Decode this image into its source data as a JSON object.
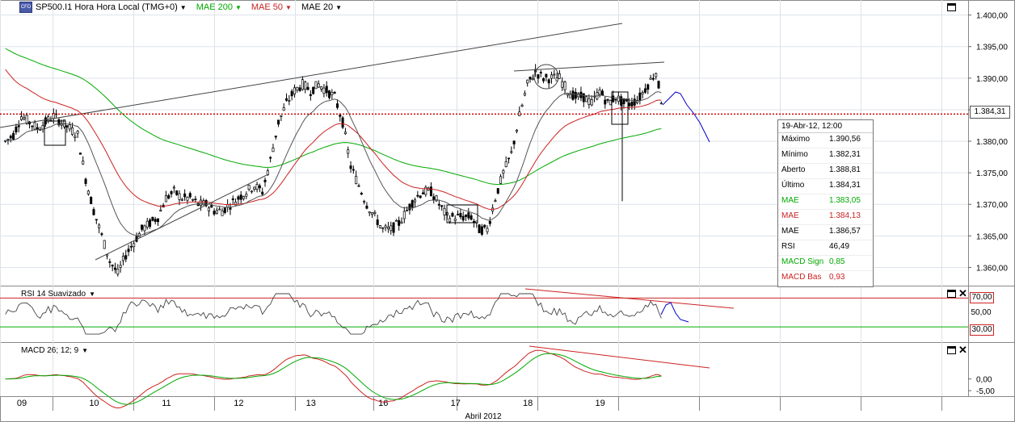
{
  "header": {
    "symbol_icon": "chart-logo-icon",
    "title": "SP500.I1 Hora Hora Local (TMG+0)",
    "indicators": [
      {
        "label": "MAE 200",
        "color": "#00aa00"
      },
      {
        "label": "MAE 50",
        "color": "#cc2222"
      },
      {
        "label": "MAE 20",
        "color": "#000000"
      }
    ]
  },
  "last_price_label": "1.384,31",
  "info_panel": {
    "date": "19-Abr-12, 12:00",
    "rows": [
      {
        "label": "Máximo",
        "value": "1.390,56",
        "color": "#000000"
      },
      {
        "label": "Mínimo",
        "value": "1.382,31",
        "color": "#000000"
      },
      {
        "label": "Aberto",
        "value": "1.388,81",
        "color": "#000000"
      },
      {
        "label": "Último",
        "value": "1.384,31",
        "color": "#000000"
      },
      {
        "label": "MAE",
        "value": "1.383,05",
        "color": "#00aa00"
      },
      {
        "label": "MAE",
        "value": "1.384,13",
        "color": "#cc2222"
      },
      {
        "label": "MAE",
        "value": "1.386,57",
        "color": "#000000"
      },
      {
        "label": "RSI",
        "value": "46,49",
        "color": "#000000"
      },
      {
        "label": "MACD Sign",
        "value": "0,85",
        "color": "#00aa00"
      },
      {
        "label": "MACD Bas",
        "value": "0,93",
        "color": "#cc2222"
      }
    ]
  },
  "rsi_pane": {
    "label": "RSI 14 Suavizado",
    "upper_label": "70,00",
    "lower_label": "30,00",
    "mid_label": "50,00"
  },
  "macd_pane": {
    "label": "MACD 26; 12; 9",
    "tick_labels": [
      "0,00",
      "-5,00"
    ]
  },
  "x_axis": {
    "month_label": "Abril 2012"
  },
  "chart_data": {
    "type": "candlestick",
    "price_axis": {
      "ticks": [
        "1.400,00",
        "1.395,00",
        "1.390,00",
        "1.385,00",
        "1.380,00",
        "1.375,00",
        "1.370,00",
        "1.365,00",
        "1.360,00"
      ],
      "ylim": [
        1357.5,
        1402
      ]
    },
    "day_labels": [
      {
        "label": "09",
        "hour": 0
      },
      {
        "label": "10",
        "hour": 9
      },
      {
        "label": "11",
        "hour": 18
      },
      {
        "label": "12",
        "hour": 27
      },
      {
        "label": "13",
        "hour": 36
      },
      {
        "label": "16",
        "hour": 45
      },
      {
        "label": "17",
        "hour": 54
      },
      {
        "label": "18",
        "hour": 63
      },
      {
        "label": "19",
        "hour": 72
      }
    ],
    "close_path": [
      1380,
      1381,
      1384,
      1383,
      1382,
      1383,
      1384,
      1383,
      1382,
      1381,
      1374,
      1369,
      1365,
      1361,
      1359,
      1362,
      1364,
      1366,
      1367,
      1368,
      1371,
      1372,
      1371,
      1371,
      1370,
      1370,
      1369,
      1369,
      1370,
      1371,
      1372,
      1373,
      1372,
      1377,
      1383,
      1386,
      1388,
      1389,
      1388,
      1389,
      1388,
      1387,
      1383,
      1376,
      1373,
      1370,
      1368,
      1366,
      1366,
      1367,
      1369,
      1371,
      1372,
      1372,
      1370,
      1368,
      1368,
      1368,
      1368,
      1366,
      1366,
      1371,
      1375,
      1378,
      1384,
      1389,
      1391,
      1390,
      1390,
      1390,
      1388,
      1387,
      1387,
      1386,
      1388,
      1386,
      1387,
      1386,
      1386,
      1387,
      1389,
      1391,
      1384.3
    ]
  }
}
